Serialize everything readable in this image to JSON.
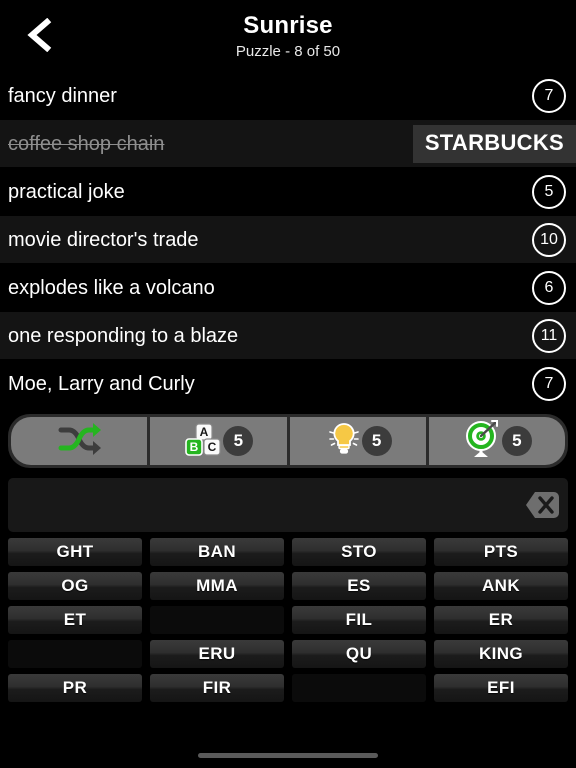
{
  "header": {
    "back_icon": "chevron-left-icon",
    "title": "Sunrise",
    "subtitle": "Puzzle - 8 of 50"
  },
  "clues": [
    {
      "text": "fancy dinner",
      "length": "7",
      "solved": false,
      "answer": ""
    },
    {
      "text": "coffee shop chain",
      "length": "",
      "solved": true,
      "answer": "STARBUCKS"
    },
    {
      "text": "practical joke",
      "length": "5",
      "solved": false,
      "answer": ""
    },
    {
      "text": "movie director's trade",
      "length": "10",
      "solved": false,
      "answer": ""
    },
    {
      "text": "explodes like a volcano",
      "length": "6",
      "solved": false,
      "answer": ""
    },
    {
      "text": "one responding to a blaze",
      "length": "11",
      "solved": false,
      "answer": ""
    },
    {
      "text": "Moe, Larry and Curly",
      "length": "7",
      "solved": false,
      "answer": ""
    }
  ],
  "powerups": [
    {
      "name": "shuffle",
      "icon": "shuffle-icon",
      "count": ""
    },
    {
      "name": "letters",
      "icon": "letter-blocks-icon",
      "count": "5"
    },
    {
      "name": "hint",
      "icon": "lightbulb-icon",
      "count": "5"
    },
    {
      "name": "target",
      "icon": "target-icon",
      "count": "5"
    }
  ],
  "answer_input": {
    "value": "",
    "placeholder": "",
    "delete_icon": "backspace-delete-icon",
    "delete_label": "X"
  },
  "tiles": [
    "GHT",
    "BAN",
    "STO",
    "PTS",
    "OG",
    "MMA",
    "ES",
    "ANK",
    "ET",
    "",
    "FIL",
    "ER",
    "",
    "ERU",
    "QU",
    "KING",
    "PR",
    "FIR",
    "",
    "EFI"
  ],
  "colors": {
    "background": "#000000",
    "row_alt": "#141414",
    "accent_green": "#25b520",
    "accent_yellow": "#f6c845",
    "badge_gray": "#3c3c3c",
    "toolbar_button": "#7b7b7b",
    "answer_badge": "#333333",
    "solved_text": "#8e8e8e"
  },
  "home_indicator": "home-indicator-bar"
}
